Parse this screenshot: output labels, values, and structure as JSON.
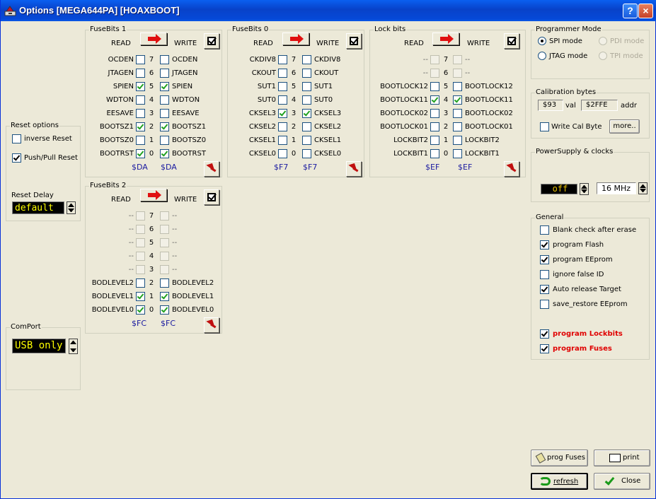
{
  "window": {
    "title": "Options [MEGA644PA] [HOAXBOOT]"
  },
  "titlebar": {
    "help": "?",
    "close": "×"
  },
  "labels": {
    "read": "READ",
    "write": "WRITE"
  },
  "fusebits1": {
    "title": "FuseBits 1",
    "rows": [
      {
        "name": "OCDEN",
        "bit": "7",
        "read": false,
        "write": false,
        "wname": "OCDEN"
      },
      {
        "name": "JTAGEN",
        "bit": "6",
        "read": false,
        "write": false,
        "wname": "JTAGEN"
      },
      {
        "name": "SPIEN",
        "bit": "5",
        "read": true,
        "write": true,
        "wname": "SPIEN"
      },
      {
        "name": "WDTON",
        "bit": "4",
        "read": false,
        "write": false,
        "wname": "WDTON"
      },
      {
        "name": "EESAVE",
        "bit": "3",
        "read": false,
        "write": false,
        "wname": "EESAVE"
      },
      {
        "name": "BOOTSZ1",
        "bit": "2",
        "read": true,
        "write": true,
        "wname": "BOOTSZ1"
      },
      {
        "name": "BOOTSZ0",
        "bit": "1",
        "read": false,
        "write": false,
        "wname": "BOOTSZ0"
      },
      {
        "name": "BOOTRST",
        "bit": "0",
        "read": true,
        "write": true,
        "wname": "BOOTRST"
      }
    ],
    "read_hex": "$DA",
    "write_hex": "$DA"
  },
  "fusebits0": {
    "title": "FuseBits 0",
    "rows": [
      {
        "name": "CKDIV8",
        "bit": "7",
        "read": false,
        "write": false,
        "wname": "CKDIV8"
      },
      {
        "name": "CKOUT",
        "bit": "6",
        "read": false,
        "write": false,
        "wname": "CKOUT"
      },
      {
        "name": "SUT1",
        "bit": "5",
        "read": false,
        "write": false,
        "wname": "SUT1"
      },
      {
        "name": "SUT0",
        "bit": "4",
        "read": false,
        "write": false,
        "wname": "SUT0"
      },
      {
        "name": "CKSEL3",
        "bit": "3",
        "read": true,
        "write": true,
        "wname": "CKSEL3"
      },
      {
        "name": "CKSEL2",
        "bit": "2",
        "read": false,
        "write": false,
        "wname": "CKSEL2"
      },
      {
        "name": "CKSEL1",
        "bit": "1",
        "read": false,
        "write": false,
        "wname": "CKSEL1"
      },
      {
        "name": "CKSEL0",
        "bit": "0",
        "read": false,
        "write": false,
        "wname": "CKSEL0"
      }
    ],
    "read_hex": "$F7",
    "write_hex": "$F7"
  },
  "lockbits": {
    "title": "Lock bits",
    "rows": [
      {
        "name": "--",
        "bit": "7",
        "read": false,
        "write": false,
        "wname": "--",
        "dis": true
      },
      {
        "name": "--",
        "bit": "6",
        "read": false,
        "write": false,
        "wname": "--",
        "dis": true
      },
      {
        "name": "BOOTLOCK12",
        "bit": "5",
        "read": false,
        "write": false,
        "wname": "BOOTLOCK12"
      },
      {
        "name": "BOOTLOCK11",
        "bit": "4",
        "read": true,
        "write": true,
        "wname": "BOOTLOCK11"
      },
      {
        "name": "BOOTLOCK02",
        "bit": "3",
        "read": false,
        "write": false,
        "wname": "BOOTLOCK02"
      },
      {
        "name": "BOOTLOCK01",
        "bit": "2",
        "read": false,
        "write": false,
        "wname": "BOOTLOCK01"
      },
      {
        "name": "LOCKBIT2",
        "bit": "1",
        "read": false,
        "write": false,
        "wname": "LOCKBIT2"
      },
      {
        "name": "LOCKBIT1",
        "bit": "0",
        "read": false,
        "write": false,
        "wname": "LOCKBIT1"
      }
    ],
    "read_hex": "$EF",
    "write_hex": "$EF"
  },
  "fusebits2": {
    "title": "FuseBits 2",
    "rows": [
      {
        "name": "--",
        "bit": "7",
        "read": false,
        "write": false,
        "wname": "--",
        "dis": true
      },
      {
        "name": "--",
        "bit": "6",
        "read": false,
        "write": false,
        "wname": "--",
        "dis": true
      },
      {
        "name": "--",
        "bit": "5",
        "read": false,
        "write": false,
        "wname": "--",
        "dis": true
      },
      {
        "name": "--",
        "bit": "4",
        "read": false,
        "write": false,
        "wname": "--",
        "dis": true
      },
      {
        "name": "--",
        "bit": "3",
        "read": false,
        "write": false,
        "wname": "--",
        "dis": true
      },
      {
        "name": "BODLEVEL2",
        "bit": "2",
        "read": false,
        "write": false,
        "wname": "BODLEVEL2"
      },
      {
        "name": "BODLEVEL1",
        "bit": "1",
        "read": true,
        "write": true,
        "wname": "BODLEVEL1"
      },
      {
        "name": "BODLEVEL0",
        "bit": "0",
        "read": true,
        "write": true,
        "wname": "BODLEVEL0"
      }
    ],
    "read_hex": "$FC",
    "write_hex": "$FC"
  },
  "reset": {
    "title": "Reset options",
    "inverse": "inverse Reset",
    "inverse_checked": false,
    "pushpull": "Push/Pull Reset",
    "pushpull_checked": true,
    "delay_label": "Reset Delay",
    "delay_value": "default"
  },
  "comport": {
    "title": "ComPort",
    "value": "USB only"
  },
  "programmer": {
    "title": "Programmer Mode",
    "spi": "SPI mode",
    "pdi": "PDI mode",
    "jtag": "JTAG mode",
    "tpi": "TPI mode",
    "selected": "spi"
  },
  "calibration": {
    "title": "Calibration bytes",
    "val": "$93",
    "val_label": "val",
    "addr": "$2FFE",
    "addr_label": "addr",
    "write_cal": "Write Cal Byte",
    "more": "more.."
  },
  "power": {
    "title": "PowerSupply & clocks",
    "supply": "off",
    "clock": "16 MHz"
  },
  "general": {
    "title": "General",
    "items": [
      {
        "label": "Blank check after erase",
        "checked": false,
        "red": false
      },
      {
        "label": "program Flash",
        "checked": true,
        "red": false
      },
      {
        "label": "program EEprom",
        "checked": true,
        "red": false
      },
      {
        "label": "ignore false ID",
        "checked": false,
        "red": false
      },
      {
        "label": "Auto release Target",
        "checked": true,
        "red": false
      },
      {
        "label": "save_restore EEprom",
        "checked": false,
        "red": false
      },
      {
        "label": "program Lockbits",
        "checked": true,
        "red": true
      },
      {
        "label": "program Fuses",
        "checked": true,
        "red": true
      }
    ]
  },
  "buttons": {
    "prog_fuses": "prog Fuses",
    "print": "print",
    "refresh": "refresh",
    "close": "Close"
  },
  "colors": {
    "title_blue": "#0842c9",
    "hex_blue": "#1a1aa0",
    "check_green": "#21a121",
    "accent_red": "#e00000",
    "display_yellow": "#ffff00"
  }
}
